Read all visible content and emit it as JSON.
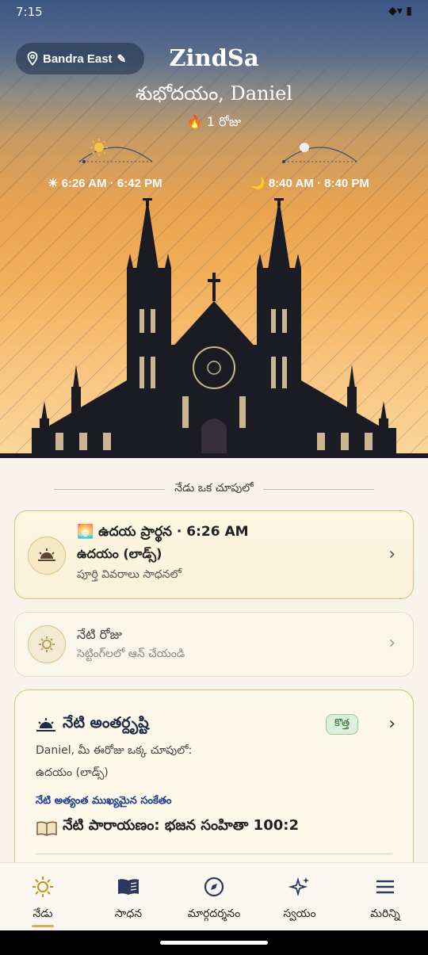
{
  "status": {
    "time": "7:15",
    "icons": "◆▾ ▮"
  },
  "header": {
    "location": "Bandra East",
    "title": "ZindSa",
    "greeting": "శుభోదయం, Daniel",
    "streak": "🔥 1 రోజు",
    "sun_times": "☀ 6:26 AM · 6:42 PM",
    "moon_times": "🌙 8:40 AM · 8:40 PM"
  },
  "glance": {
    "heading": "నేడు ఒక చూపులో",
    "prayer_card": {
      "title": "🌅 ఉదయ ప్రార్థన · 6:26 AM",
      "name": "ఉదయం (లాడ్స్)",
      "detail": "పూర్తి వివరాలు సాధనలో"
    },
    "fast_card": {
      "title": "నేటి రోజు",
      "detail": "సెట్టింగ్‌లలో ఆన్ చేయండి"
    },
    "insight_card": {
      "title": "నేటి అంతర్దృష్టి",
      "badge": "కొత్త",
      "line1": "Daniel, మీ ఈరోజు ఒక్క చూపులో:",
      "line2": "ఉదయం (లాడ్స్)",
      "signal_label": "నేటి అత్యంత ముఖ్యమైన సంకేతం",
      "reading": "నేటి పారాయణం: భజన సంహితా 100:2"
    }
  },
  "tabs": [
    {
      "label": "నేడు",
      "icon": "sun-icon"
    },
    {
      "label": "సాధన",
      "icon": "book-icon"
    },
    {
      "label": "మార్గదర్శనం",
      "icon": "compass-icon"
    },
    {
      "label": "స్వయం",
      "icon": "sparkles-icon"
    },
    {
      "label": "మరిన్ని",
      "icon": "menu-icon"
    }
  ],
  "colors": {
    "accent": "#e6a94d",
    "navy": "#1e2a4a",
    "badge_green": "#2d6a2d"
  }
}
